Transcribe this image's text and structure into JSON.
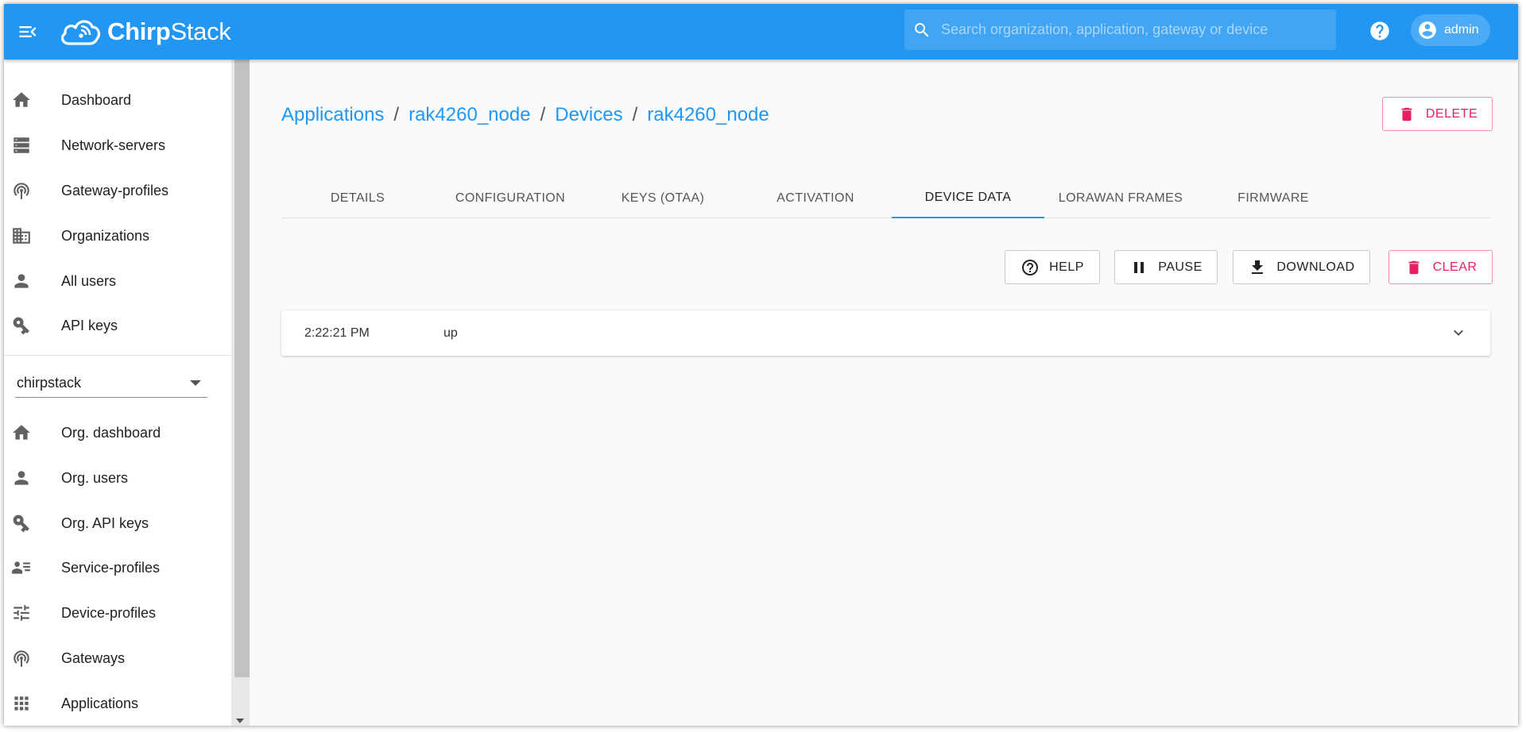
{
  "header": {
    "brand_bold": "Chirp",
    "brand_light": "Stack",
    "search_placeholder": "Search organization, application, gateway or device",
    "user": "admin"
  },
  "sidebar": {
    "items": [
      {
        "label": "Dashboard",
        "icon": "home-icon"
      },
      {
        "label": "Network-servers",
        "icon": "server-icon"
      },
      {
        "label": "Gateway-profiles",
        "icon": "radio-tower-icon"
      },
      {
        "label": "Organizations",
        "icon": "building-icon"
      },
      {
        "label": "All users",
        "icon": "person-icon"
      },
      {
        "label": "API keys",
        "icon": "key-icon"
      }
    ],
    "org_select": "chirpstack",
    "org_items": [
      {
        "label": "Org. dashboard",
        "icon": "home-icon"
      },
      {
        "label": "Org. users",
        "icon": "person-icon"
      },
      {
        "label": "Org. API keys",
        "icon": "key-icon"
      },
      {
        "label": "Service-profiles",
        "icon": "account-details-icon"
      },
      {
        "label": "Device-profiles",
        "icon": "tune-icon"
      },
      {
        "label": "Gateways",
        "icon": "radio-tower-icon"
      },
      {
        "label": "Applications",
        "icon": "apps-grid-icon"
      }
    ]
  },
  "breadcrumb": [
    "Applications",
    "rak4260_node",
    "Devices",
    "rak4260_node"
  ],
  "buttons": {
    "delete": "DELETE",
    "help": "HELP",
    "pause": "PAUSE",
    "download": "DOWNLOAD",
    "clear": "CLEAR"
  },
  "tabs": [
    "DETAILS",
    "CONFIGURATION",
    "KEYS (OTAA)",
    "ACTIVATION",
    "DEVICE DATA",
    "LORAWAN FRAMES",
    "FIRMWARE"
  ],
  "active_tab": "DEVICE DATA",
  "frames": [
    {
      "time": "2:22:21 PM",
      "type": "up"
    }
  ],
  "colors": {
    "primary": "#2196f3",
    "danger": "#e91e63"
  }
}
